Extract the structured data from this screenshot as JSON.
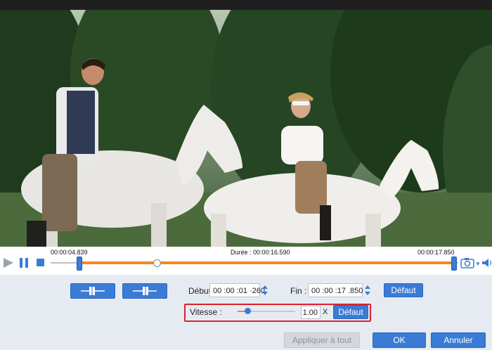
{
  "timeline": {
    "start_time": "00:00:04.839",
    "duration": "Durée : 00:00:16.590",
    "end_time": "00:00:17.850",
    "scrub_position": 0.26
  },
  "trim": {
    "start_label": "Début",
    "start_value": "00 :00 :01 ·260",
    "end_label": "Fin :",
    "end_value": "00 :00 :17 .850",
    "default_label": "Défaut"
  },
  "speed": {
    "label": "Vitesse :",
    "value": "1.00",
    "unit": "X",
    "default_label": "Défaut",
    "slider_level": 0.17
  },
  "footer": {
    "apply_all": "Appliquer à tout",
    "ok": "OK",
    "cancel": "Annuler"
  },
  "colors": {
    "accent": "#3a7bd5",
    "selection": "#f28a1d",
    "highlight": "#d9232b",
    "panel": "#e6ebf2"
  },
  "icons": [
    "play-icon",
    "pause-icon",
    "stop-icon",
    "camera-icon",
    "volume-icon",
    "split-left-icon",
    "split-right-icon"
  ]
}
